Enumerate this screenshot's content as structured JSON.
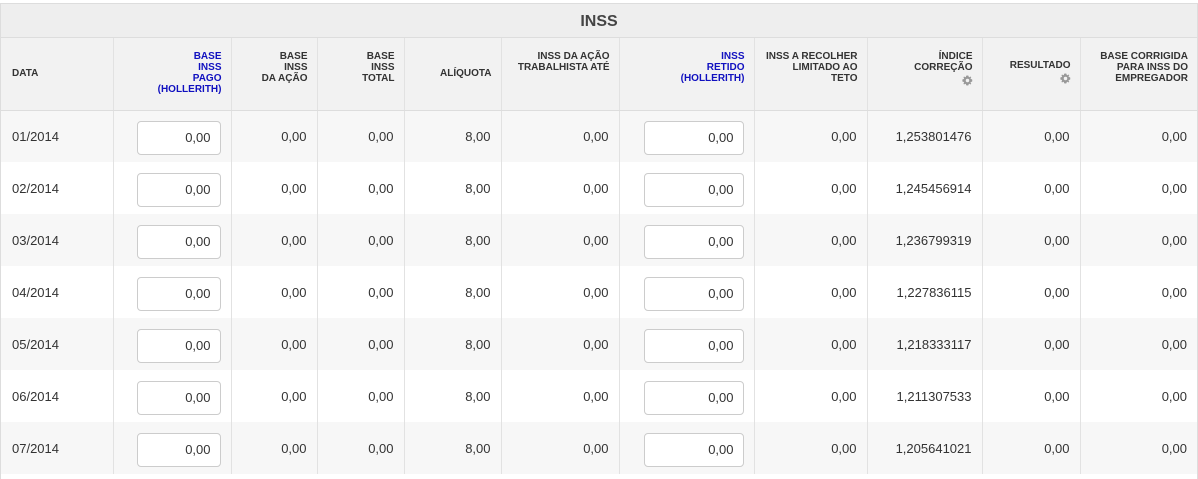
{
  "panel": {
    "title": "INSS"
  },
  "columns": [
    {
      "key": "data",
      "label": "DATA",
      "highlight": false
    },
    {
      "key": "base_pago",
      "label": "BASE INSS PAGO (HOLLERITH)",
      "highlight": true
    },
    {
      "key": "base_acao",
      "label": "BASE INSS DA AÇÃO",
      "highlight": false
    },
    {
      "key": "base_total",
      "label": "BASE INSS TOTAL",
      "highlight": false
    },
    {
      "key": "aliquota",
      "label": "ALÍQUOTA",
      "highlight": false
    },
    {
      "key": "inss_acao",
      "label": "INSS DA AÇÃO TRABALHISTA ATÉ",
      "highlight": false
    },
    {
      "key": "inss_retido",
      "label": "INSS RETIDO (HOLLERITH)",
      "highlight": true
    },
    {
      "key": "inss_recolher",
      "label": "INSS A RECOLHER LIMITADO AO TETO",
      "highlight": false
    },
    {
      "key": "indice",
      "label": "ÍNDICE CORREÇÃO",
      "highlight": false,
      "icon": "gear-icon"
    },
    {
      "key": "resultado",
      "label": "RESULTADO",
      "highlight": false,
      "icon": "gear-icon"
    },
    {
      "key": "base_corrigida",
      "label": "BASE CORRIGIDA PARA INSS DO EMPREGADOR",
      "highlight": false
    }
  ],
  "header_lines": {
    "data": [
      "DATA"
    ],
    "base_pago": [
      "BASE",
      "INSS",
      "PAGO",
      "(HOLLERITH)"
    ],
    "base_acao": [
      "BASE",
      "INSS",
      "DA AÇÃO"
    ],
    "base_total": [
      "BASE",
      "INSS",
      "TOTAL"
    ],
    "aliquota": [
      "ALÍQUOTA"
    ],
    "inss_acao": [
      "INSS DA AÇÃO",
      "TRABALHISTA ATÉ"
    ],
    "inss_retido": [
      "INSS",
      "RETIDO",
      "(HOLLERITH)"
    ],
    "inss_recolher": [
      "INSS A RECOLHER",
      "LIMITADO AO",
      "TETO"
    ],
    "indice": [
      "ÍNDICE",
      "CORREÇÃO"
    ],
    "resultado": [
      "RESULTADO"
    ],
    "base_corrigida": [
      "BASE CORRIGIDA",
      "PARA INSS DO",
      "EMPREGADOR"
    ]
  },
  "rows": [
    {
      "data": "01/2014",
      "base_pago": "0,00",
      "base_acao": "0,00",
      "base_total": "0,00",
      "aliquota": "8,00",
      "inss_acao": "0,00",
      "inss_retido": "0,00",
      "inss_recolher": "0,00",
      "indice": "1,253801476",
      "resultado": "0,00",
      "base_corrigida": "0,00"
    },
    {
      "data": "02/2014",
      "base_pago": "0,00",
      "base_acao": "0,00",
      "base_total": "0,00",
      "aliquota": "8,00",
      "inss_acao": "0,00",
      "inss_retido": "0,00",
      "inss_recolher": "0,00",
      "indice": "1,245456914",
      "resultado": "0,00",
      "base_corrigida": "0,00"
    },
    {
      "data": "03/2014",
      "base_pago": "0,00",
      "base_acao": "0,00",
      "base_total": "0,00",
      "aliquota": "8,00",
      "inss_acao": "0,00",
      "inss_retido": "0,00",
      "inss_recolher": "0,00",
      "indice": "1,236799319",
      "resultado": "0,00",
      "base_corrigida": "0,00"
    },
    {
      "data": "04/2014",
      "base_pago": "0,00",
      "base_acao": "0,00",
      "base_total": "0,00",
      "aliquota": "8,00",
      "inss_acao": "0,00",
      "inss_retido": "0,00",
      "inss_recolher": "0,00",
      "indice": "1,227836115",
      "resultado": "0,00",
      "base_corrigida": "0,00"
    },
    {
      "data": "05/2014",
      "base_pago": "0,00",
      "base_acao": "0,00",
      "base_total": "0,00",
      "aliquota": "8,00",
      "inss_acao": "0,00",
      "inss_retido": "0,00",
      "inss_recolher": "0,00",
      "indice": "1,218333117",
      "resultado": "0,00",
      "base_corrigida": "0,00"
    },
    {
      "data": "06/2014",
      "base_pago": "0,00",
      "base_acao": "0,00",
      "base_total": "0,00",
      "aliquota": "8,00",
      "inss_acao": "0,00",
      "inss_retido": "0,00",
      "inss_recolher": "0,00",
      "indice": "1,211307533",
      "resultado": "0,00",
      "base_corrigida": "0,00"
    },
    {
      "data": "07/2014",
      "base_pago": "0,00",
      "base_acao": "0,00",
      "base_total": "0,00",
      "aliquota": "8,00",
      "inss_acao": "0,00",
      "inss_retido": "0,00",
      "inss_recolher": "0,00",
      "indice": "1,205641021",
      "resultado": "0,00",
      "base_corrigida": "0,00"
    }
  ],
  "colors": {
    "highlight_header": "#1010c0",
    "header_bg": "#f2f2f2",
    "row_alt": "#f7f7f7"
  }
}
